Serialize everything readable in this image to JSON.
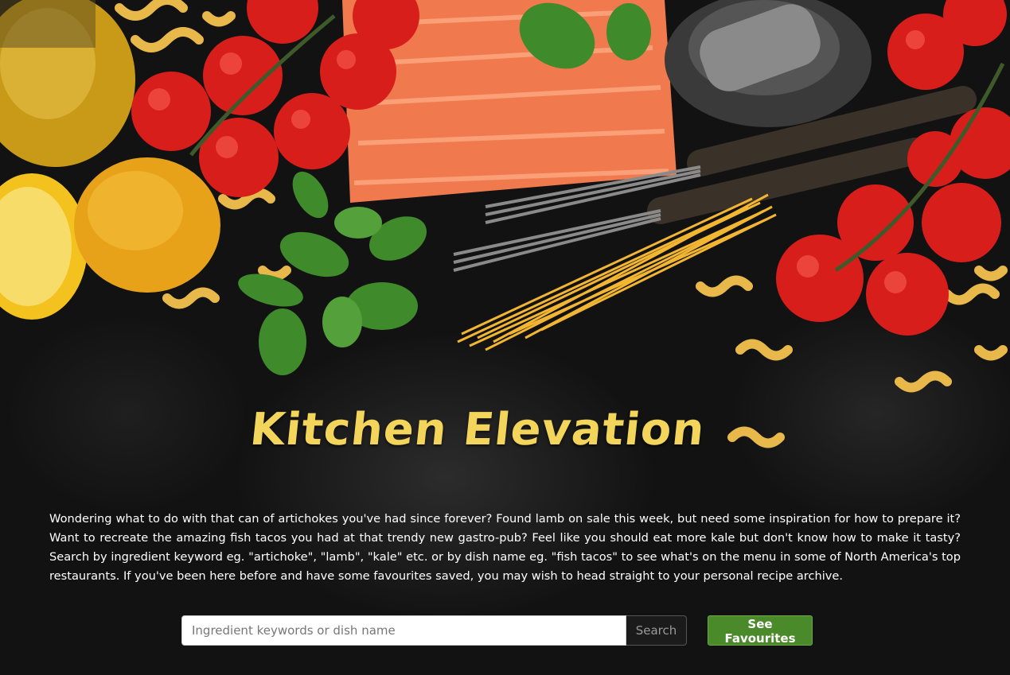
{
  "hero": {
    "title": "Kitchen Elevation",
    "intro": "Wondering what to do with that can of artichokes you've had since forever? Found lamb on sale this week, but need some inspiration for how to prepare it? Want to recreate the amazing fish tacos you had at that trendy new gastro-pub? Feel like you should eat more kale but don't know how to make it tasty? Search by ingredient keyword eg. \"artichoke\", \"lamb\", \"kale\" etc. or by dish name eg. \"fish tacos\" to see what's on the menu in some of North America's top restaurants. If you've been here before and have some favourites saved, you may wish to head straight to your personal recipe archive."
  },
  "search": {
    "placeholder": "Ingredient keywords or dish name",
    "value": "",
    "button_label": "Search"
  },
  "favourites": {
    "button_label": "See Favourites"
  },
  "colors": {
    "title": "#f2d55a",
    "favourites_button": "#4a8a2a",
    "background": "#121212"
  }
}
